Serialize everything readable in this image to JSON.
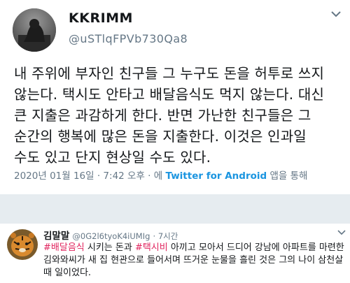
{
  "tweet": {
    "display_name": "KKRIMM",
    "handle": "@uSTlqFPVb730Qa8",
    "text": "내 주위에 부자인 친구들 그 누구도 돈을 허투로 쓰지\n않는다. 택시도 안타고 배달음식도 먹지 않는다. 대신\n큰 지출은 과감하게 한다. 반면 가난한 친구들은 그\n순간의 행복에 많은 돈을 지출한다. 이것은 인과일\n수도 있고 단지 현상일 수도 있다.",
    "timestamp": "2020년 01월 16일 · 7:42 오후 · 에 ",
    "source": "Twitter for Android",
    "source_suffix": " 앱을 통해"
  },
  "reply": {
    "display_name": "김말말",
    "handle": "@0G2l6tyoK4iUMIg",
    "time": "· 7시간",
    "hashtag1": "#배달음식",
    "text1": " 시키는 돈과 ",
    "hashtag2": "#택시비",
    "text2": " 아끼고 모아서 드디어 강남에 아파트를 마련한 김와와씨가 새 집 현관으로 들어서며 뜨거운 눈물을 흘린 것은 그의 나이 삼천살 때 일이었다."
  },
  "colors": {
    "link": "#1b95e0",
    "hashtag": "#e0245e",
    "muted": "#657786",
    "separator": "#e6ecf0"
  },
  "icons": {
    "chevron": "chevron-down-icon"
  }
}
